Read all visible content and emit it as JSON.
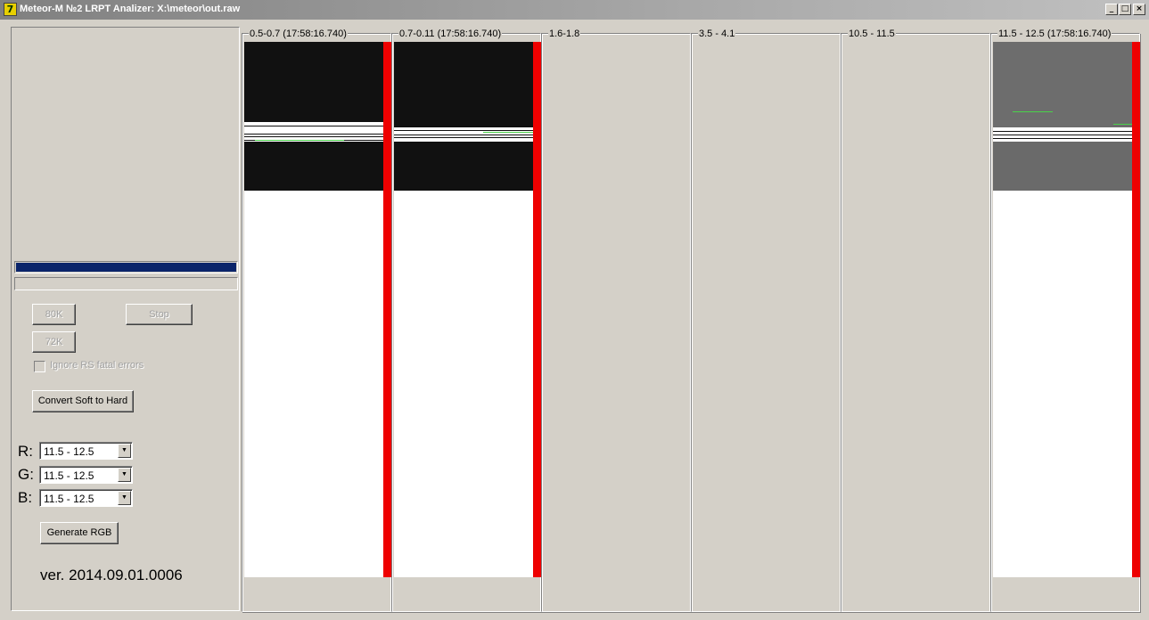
{
  "window": {
    "title": "Meteor-M №2 LRPT Analizer: X:\\meteor\\out.raw",
    "icon": "app-icon",
    "controls": {
      "minimize": "_",
      "maximize": "□",
      "close": "×"
    }
  },
  "left": {
    "progress": [
      1.0,
      0.0
    ],
    "buttons": {
      "k80": "80K",
      "stop": "Stop",
      "k72": "72K",
      "convert": "Convert Soft to Hard",
      "generate": "Generate RGB"
    },
    "ignore_rs_label": "Ignore RS fatal errors",
    "ignore_rs_checked": false,
    "rgb": {
      "r_label": "R:",
      "r_value": "11.5 - 12.5",
      "g_label": "G:",
      "g_value": "11.5 - 12.5",
      "b_label": "B:",
      "b_value": "11.5 - 12.5"
    },
    "version": "ver. 2014.09.01.0006"
  },
  "channels": [
    {
      "label": "0.5-0.7 (17:58:16.740)"
    },
    {
      "label": "0.7-0.11 (17:58:16.740)"
    },
    {
      "label": "1.6-1.8"
    },
    {
      "label": "3.5 - 4.1"
    },
    {
      "label": "10.5 - 11.5"
    },
    {
      "label": "11.5 - 12.5 (17:58:16.740)"
    }
  ],
  "colors": {
    "accent": "#0a246a",
    "level_bar": "#ee0000",
    "face": "#d4d0c8"
  }
}
